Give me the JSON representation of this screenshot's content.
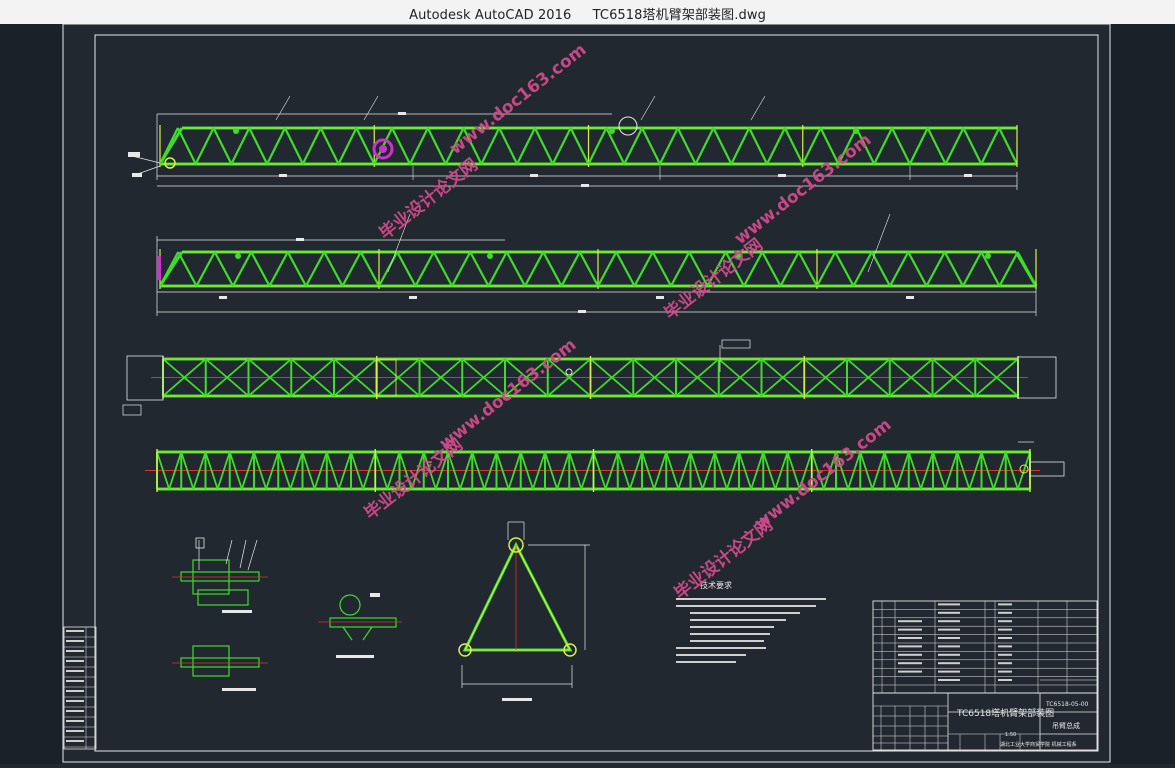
{
  "window": {
    "app_name": "Autodesk AutoCAD 2016",
    "document_name": "TC6518塔机臂架部装图.dwg"
  },
  "drawing": {
    "background": "#212830",
    "frame_color": "#e8e8e8",
    "truss_color": "#3fdc2a",
    "truss_highlight": "#d9f04a",
    "centerline_color": "#e03030",
    "hub_color": "#cc33cc"
  },
  "watermark": {
    "text_cn": "毕业设计论文网",
    "text_url": "www.doc163.com",
    "color": "#d04a8a"
  },
  "tech_requirements": {
    "heading": "技术要求"
  },
  "title_block": {
    "drawing_title": "TC6518塔机臂架部装图",
    "drawing_code": "TC6518-05-00",
    "part_name": "吊臂总成",
    "school": "湖北工业大学商贸学院  机械工程系",
    "scale": "1:50"
  }
}
